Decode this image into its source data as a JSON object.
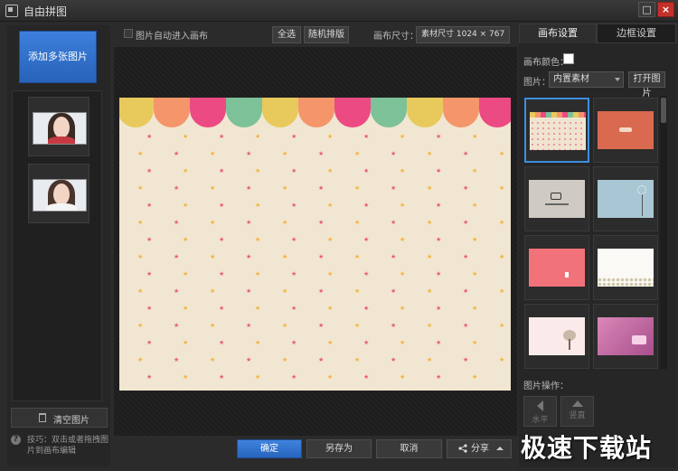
{
  "window": {
    "title": "自由拼图",
    "max_glyph": "□",
    "close_glyph": "×"
  },
  "left": {
    "add_button": "添加多张图片",
    "clear_button": "清空图片",
    "tip_icon": "?",
    "tip": "技巧：双击或者拖拽图片到画布编辑"
  },
  "toolbar": {
    "auto_label": "图片自动进入画布",
    "select_all": "全选",
    "random_sort": "随机排版",
    "size_label": "画布尺寸：",
    "size_value": "素材尺寸 1024 × 767"
  },
  "bottom": {
    "confirm": "确定",
    "save_as": "另存为",
    "cancel": "取消",
    "share": "分享"
  },
  "right": {
    "tab_canvas": "画布设置",
    "tab_border": "边框设置",
    "color_label": "画布颜色：",
    "image_label": "图片：",
    "image_select": "内置素材",
    "open_button": "打开图片",
    "ops_label": "图片操作：",
    "op_horizontal": "水平",
    "op_vertical": "竖直"
  },
  "colors": {
    "accent": "#3d8fe0",
    "canvas_bg": "#f1e6d1",
    "scallops": [
      "#e8c95c",
      "#f4956a",
      "#ec4a83",
      "#7cc197",
      "#e8c95c",
      "#f4956a",
      "#ec4a83",
      "#7cc197",
      "#e8c95c",
      "#f4956a",
      "#ec4a83"
    ],
    "star_pink": "#e85c7a",
    "star_yellow": "#f2b43c"
  },
  "watermark": "极速下载站"
}
